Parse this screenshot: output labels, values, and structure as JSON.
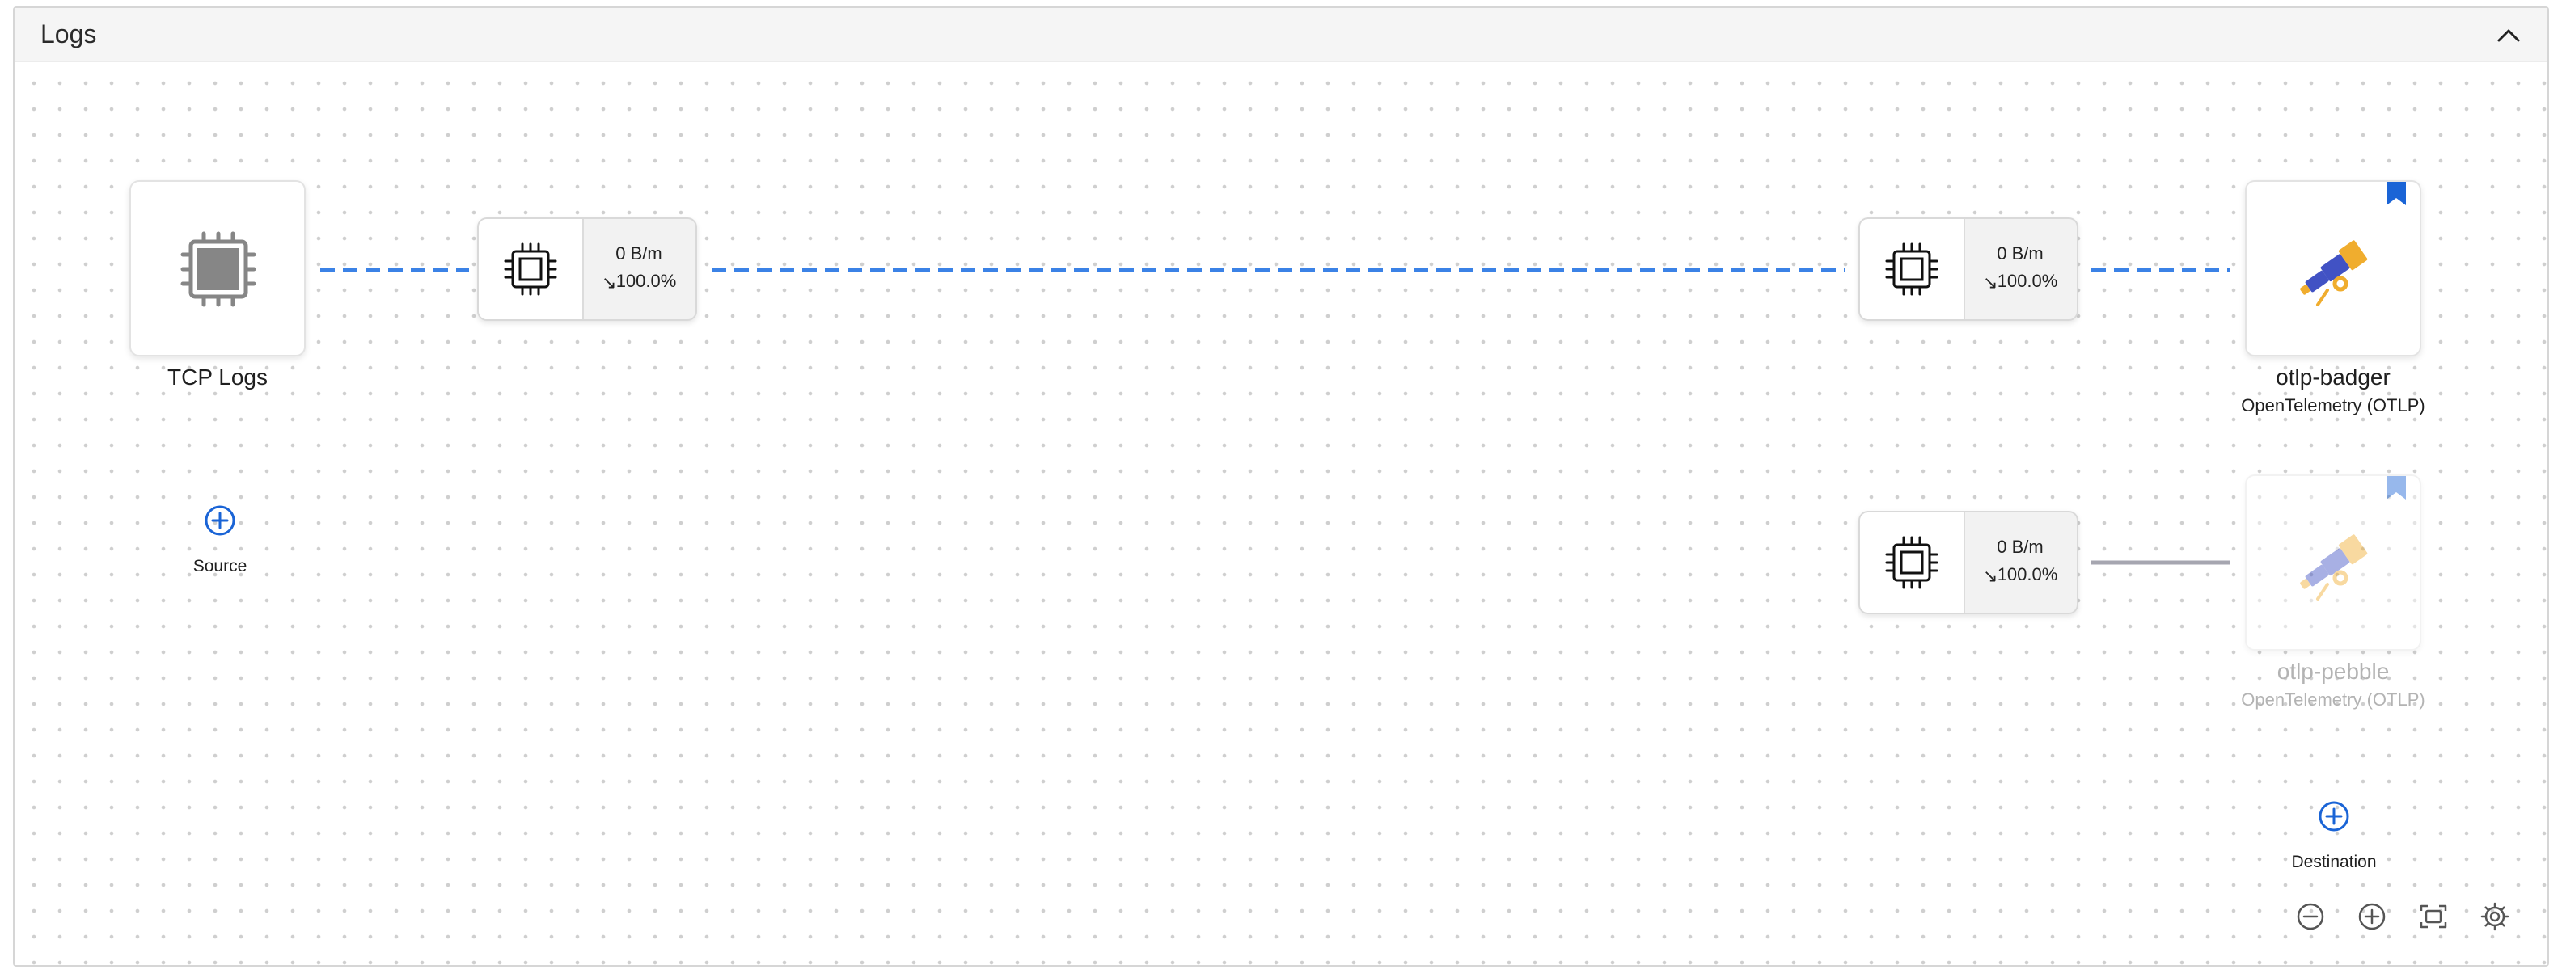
{
  "panel": {
    "title": "Logs"
  },
  "source_node": {
    "name": "TCP Logs"
  },
  "add_source": {
    "label": "Source"
  },
  "processors": [
    {
      "rate": "0 B/m",
      "percent": "100.0%"
    },
    {
      "rate": "0 B/m",
      "percent": "100.0%"
    },
    {
      "rate": "0 B/m",
      "percent": "100.0%"
    }
  ],
  "destinations": [
    {
      "name": "otlp-badger",
      "type": "OpenTelemetry (OTLP)"
    },
    {
      "name": "otlp-pebble",
      "type": "OpenTelemetry (OTLP)"
    }
  ],
  "add_destination": {
    "label": "Destination"
  },
  "icons": {
    "collapse": "chevron-up-icon",
    "source": "cpu-chip-icon",
    "processor": "processor-chip-icon",
    "destination": "telescope-icon",
    "bookmark": "bookmark-icon",
    "add": "plus-circle-icon",
    "zoom_out": "zoom-out-icon",
    "zoom_in": "zoom-in-icon",
    "fit": "fit-view-icon",
    "settings": "gear-icon"
  },
  "colors": {
    "active_edge": "#3b82e6",
    "inactive_edge": "#a6a6b0",
    "accent_blue": "#1a64d6",
    "telescope_body": "#4152c4",
    "telescope_accent": "#f0ad2e"
  }
}
